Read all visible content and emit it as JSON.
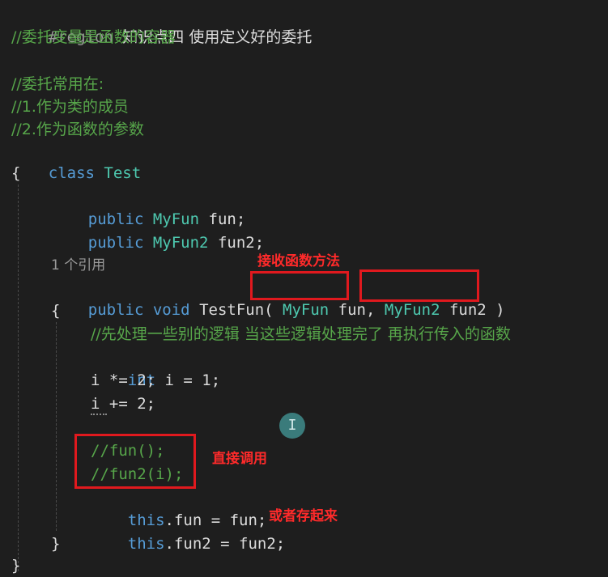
{
  "code": {
    "region": "#region",
    "region_title": "知识点四 使用定义好的委托",
    "c1": "//委托变量是函数的容器",
    "c2": "//委托常用在:",
    "c3": "//1.作为类的成员",
    "c4": "//2.作为函数的参数",
    "kw_class": "class",
    "type_test": "Test",
    "brace_open": "{",
    "brace_close": "}",
    "kw_public": "public",
    "kw_void": "void",
    "kw_int": "int",
    "kw_this": "this",
    "type_myfun": "MyFun",
    "type_myfun2": "MyFun2",
    "f1_rest": " fun;",
    "f2_rest": " fun2;",
    "refcount": "1 个引用",
    "method_name": " TestFun( ",
    "param1_name": " fun",
    "comma": ", ",
    "param2_name": " fun2",
    "close_paren": " )",
    "comment_process": "//先处理一些别的逻辑 当这些逻辑处理完了 再执行传入的函数",
    "int_rest": " i = 1;",
    "mul_line": "i *= 2;",
    "add_line": "i += 2;",
    "call1": "//fun();",
    "call2": "//fun2(i);",
    "assign1_rest": ".fun = fun;",
    "assign2_rest": ".fun2 = fun2;"
  },
  "annotations": {
    "receive": "接收函数方法",
    "direct_call": "直接调用",
    "or_store": "或者存起来"
  },
  "cursor_glyph": "I"
}
